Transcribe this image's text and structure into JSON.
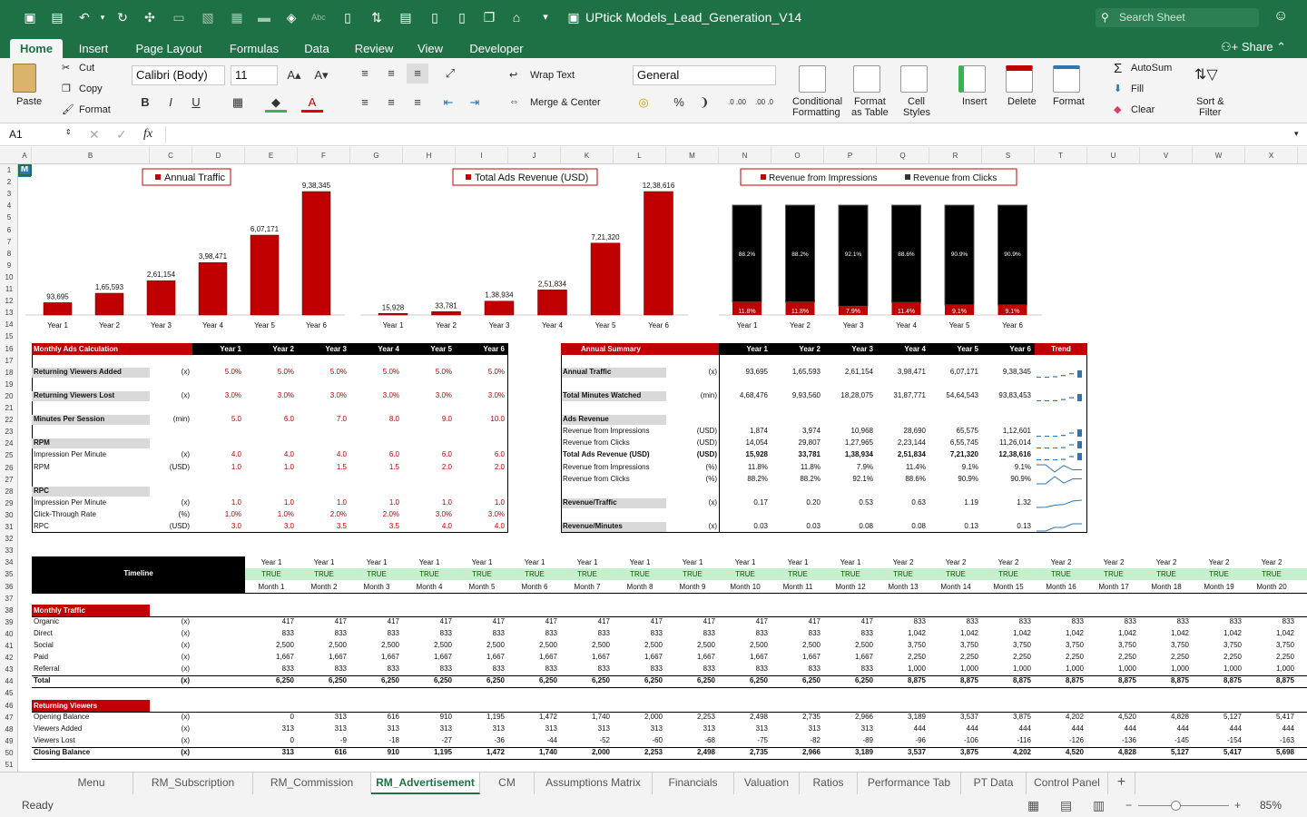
{
  "app": {
    "doc_title": "UPtick Models_Lead_Generation_V14",
    "search_placeholder": "Search Sheet",
    "share": "Share"
  },
  "ribbon_tabs": [
    "Home",
    "Insert",
    "Page Layout",
    "Formulas",
    "Data",
    "Review",
    "View",
    "Developer"
  ],
  "ribbon": {
    "paste": "Paste",
    "cut": "Cut",
    "copy": "Copy",
    "format_painter": "Format",
    "font_name": "Calibri (Body)",
    "font_size": "11",
    "wrap_text": "Wrap Text",
    "merge_center": "Merge & Center",
    "number_format": "General",
    "percent": "%",
    "conditional_formatting_1": "Conditional",
    "conditional_formatting_2": "Formatting",
    "format_table_1": "Format",
    "format_table_2": "as Table",
    "cell_styles_1": "Cell",
    "cell_styles_2": "Styles",
    "insert": "Insert",
    "delete": "Delete",
    "format": "Format",
    "autosum": "AutoSum",
    "fill": "Fill",
    "clear": "Clear",
    "sort_filter_1": "Sort &",
    "sort_filter_2": "Filter"
  },
  "name_box": "A1",
  "fx": "fx",
  "columns": [
    "A",
    "B",
    "C",
    "D",
    "E",
    "F",
    "G",
    "H",
    "I",
    "J",
    "K",
    "L",
    "M",
    "N",
    "O",
    "P",
    "Q",
    "R",
    "S",
    "T",
    "U",
    "V",
    "W",
    "X"
  ],
  "rows": [
    "1",
    "2",
    "3",
    "4",
    "5",
    "6",
    "7",
    "8",
    "9",
    "10",
    "11",
    "12",
    "13",
    "14",
    "15",
    "16",
    "17",
    "18",
    "19",
    "20",
    "21",
    "22",
    "23",
    "24",
    "25",
    "26",
    "27",
    "28",
    "29",
    "30",
    "31",
    "32",
    "33",
    "34",
    "35",
    "36",
    "37",
    "38",
    "39",
    "40",
    "41",
    "42",
    "43",
    "44",
    "45",
    "46",
    "47",
    "48",
    "49",
    "50",
    "51"
  ],
  "logo_letter": "M",
  "colors": {
    "accent": "#1e7145",
    "bar_red": "#c00000",
    "bar_black": "#000000",
    "trend_blue": "#2e75b6",
    "header_red": "#c00000",
    "timeline_green": "#c6efce"
  },
  "charts": [
    {
      "type": "bar",
      "legend": "Annual Traffic",
      "categories": [
        "Year 1",
        "Year 2",
        "Year 3",
        "Year 4",
        "Year 5",
        "Year 6"
      ],
      "values": [
        93695,
        165593,
        261154,
        398471,
        607171,
        938345
      ],
      "labels": [
        "93,695",
        "1,65,593",
        "2,61,154",
        "3,98,471",
        "6,07,171",
        "9,38,345"
      ],
      "ylim": [
        0,
        938345
      ]
    },
    {
      "type": "bar",
      "legend": "Total Ads Revenue (USD)",
      "categories": [
        "Year 1",
        "Year 2",
        "Year 3",
        "Year 4",
        "Year 5",
        "Year 6"
      ],
      "values": [
        15928,
        33781,
        138934,
        251834,
        721320,
        1238616
      ],
      "labels": [
        "15,928",
        "33,781",
        "1,38,934",
        "2,51,834",
        "7,21,320",
        "12,38,616"
      ],
      "ylim": [
        0,
        1238616
      ]
    },
    {
      "type": "stacked_bar_100",
      "legend": [
        "Revenue from Impressions",
        "Revenue from Clicks"
      ],
      "categories": [
        "Year 1",
        "Year 2",
        "Year 3",
        "Year 4",
        "Year 5",
        "Year 6"
      ],
      "series": [
        {
          "name": "Revenue from Impressions",
          "values": [
            11.8,
            11.8,
            7.9,
            11.4,
            9.1,
            9.1
          ],
          "labels": [
            "11.8%",
            "11.8%",
            "7.9%",
            "11.4%",
            "9.1%",
            "9.1%"
          ]
        },
        {
          "name": "Revenue from Clicks",
          "values": [
            88.2,
            88.2,
            92.1,
            88.6,
            90.9,
            90.9
          ],
          "labels": [
            "88.2%",
            "88.2%",
            "92.1%",
            "88.6%",
            "90.9%",
            "90.9%"
          ]
        }
      ]
    }
  ],
  "monthly_ads": {
    "title": "Monthly Ads Calculation",
    "years": [
      "Year 1",
      "Year 2",
      "Year 3",
      "Year 4",
      "Year 5",
      "Year 6"
    ],
    "rows": [
      {
        "label": "Returning Viewers Added",
        "unit": "(x)",
        "vals": [
          "5.0%",
          "5.0%",
          "5.0%",
          "5.0%",
          "5.0%",
          "5.0%"
        ],
        "hdr": true,
        "row": 18
      },
      {
        "label": "Returning Viewers Lost",
        "unit": "(x)",
        "vals": [
          "3.0%",
          "3.0%",
          "3.0%",
          "3.0%",
          "3.0%",
          "3.0%"
        ],
        "hdr": true,
        "row": 20
      },
      {
        "label": "Minutes Per Session",
        "unit": "(min)",
        "vals": [
          "5.0",
          "6.0",
          "7.0",
          "8.0",
          "9.0",
          "10.0"
        ],
        "hdr": true,
        "row": 22
      },
      {
        "label": "RPM",
        "unit": "",
        "vals": [
          "",
          "",
          "",
          "",
          "",
          ""
        ],
        "hdr": true,
        "row": 24
      },
      {
        "label": "Impression Per Minute",
        "unit": "(x)",
        "vals": [
          "4.0",
          "4.0",
          "4.0",
          "6.0",
          "6.0",
          "6.0"
        ],
        "hdr": false,
        "row": 25
      },
      {
        "label": "RPM",
        "unit": "(USD)",
        "vals": [
          "1.0",
          "1.0",
          "1.5",
          "1.5",
          "2.0",
          "2.0"
        ],
        "hdr": false,
        "row": 26
      },
      {
        "label": "RPC",
        "unit": "",
        "vals": [
          "",
          "",
          "",
          "",
          "",
          ""
        ],
        "hdr": true,
        "row": 28
      },
      {
        "label": "Impression Per Minute",
        "unit": "(x)",
        "vals": [
          "1.0",
          "1.0",
          "1.0",
          "1.0",
          "1.0",
          "1.0"
        ],
        "hdr": false,
        "row": 29
      },
      {
        "label": "Click-Through Rate",
        "unit": "(%)",
        "vals": [
          "1.0%",
          "1.0%",
          "2.0%",
          "2.0%",
          "3.0%",
          "3.0%"
        ],
        "hdr": false,
        "row": 30
      },
      {
        "label": "RPC",
        "unit": "(USD)",
        "vals": [
          "3.0",
          "3.0",
          "3.5",
          "3.5",
          "4.0",
          "4.0"
        ],
        "hdr": false,
        "row": 31
      }
    ]
  },
  "annual_summary": {
    "title": "Annual Summary",
    "years": [
      "Year 1",
      "Year 2",
      "Year 3",
      "Year 4",
      "Year 5",
      "Year 6"
    ],
    "trend": "Trend",
    "rows": [
      {
        "label": "Annual Traffic",
        "unit": "(x)",
        "vals": [
          "93,695",
          "1,65,593",
          "2,61,154",
          "3,98,471",
          "6,07,171",
          "9,38,345"
        ],
        "hdr": true,
        "bold": false,
        "row": 18,
        "trend": "bar"
      },
      {
        "label": "Total Minutes Watched",
        "unit": "(min)",
        "vals": [
          "4,68,476",
          "9,93,560",
          "18,28,075",
          "31,87,771",
          "54,64,543",
          "93,83,453"
        ],
        "hdr": true,
        "bold": false,
        "row": 20,
        "trend": "bar"
      },
      {
        "label": "Ads Revenue",
        "unit": "",
        "vals": [
          "",
          "",
          "",
          "",
          "",
          ""
        ],
        "hdr": true,
        "bold": false,
        "row": 22,
        "trend": ""
      },
      {
        "label": "Revenue from Impressions",
        "unit": "(USD)",
        "vals": [
          "1,874",
          "3,974",
          "10,968",
          "28,690",
          "65,575",
          "1,12,601"
        ],
        "hdr": false,
        "bold": false,
        "row": 23,
        "trend": "bar"
      },
      {
        "label": "Revenue from Clicks",
        "unit": "(USD)",
        "vals": [
          "14,054",
          "29,807",
          "1,27,965",
          "2,23,144",
          "6,55,745",
          "11,26,014"
        ],
        "hdr": false,
        "bold": false,
        "row": 24,
        "trend": "bar"
      },
      {
        "label": "Total Ads Revenue (USD)",
        "unit": "(USD)",
        "vals": [
          "15,928",
          "33,781",
          "1,38,934",
          "2,51,834",
          "7,21,320",
          "12,38,616"
        ],
        "hdr": false,
        "bold": true,
        "row": 25,
        "trend": "bar"
      },
      {
        "label": "Revenue from Impressions",
        "unit": "(%)",
        "vals": [
          "11.8%",
          "11.8%",
          "7.9%",
          "11.4%",
          "9.1%",
          "9.1%"
        ],
        "hdr": false,
        "bold": false,
        "row": 26,
        "trend": "line"
      },
      {
        "label": "Revenue from Clicks",
        "unit": "(%)",
        "vals": [
          "88.2%",
          "88.2%",
          "92.1%",
          "88.6%",
          "90.9%",
          "90.9%"
        ],
        "hdr": false,
        "bold": false,
        "row": 27,
        "trend": "line"
      },
      {
        "label": "Revenue/Traffic",
        "unit": "(x)",
        "vals": [
          "0.17",
          "0.20",
          "0.53",
          "0.63",
          "1.19",
          "1.32"
        ],
        "hdr": true,
        "bold": false,
        "row": 29,
        "trend": "line"
      },
      {
        "label": "Revenue/Minutes",
        "unit": "(x)",
        "vals": [
          "0.03",
          "0.03",
          "0.08",
          "0.08",
          "0.13",
          "0.13"
        ],
        "hdr": true,
        "bold": false,
        "row": 31,
        "trend": "line"
      }
    ]
  },
  "timeline": {
    "label": "Timeline",
    "years": [
      "Year 1",
      "Year 1",
      "Year 1",
      "Year 1",
      "Year 1",
      "Year 1",
      "Year 1",
      "Year 1",
      "Year 1",
      "Year 1",
      "Year 1",
      "Year 1",
      "Year 2",
      "Year 2",
      "Year 2",
      "Year 2",
      "Year 2",
      "Year 2",
      "Year 2",
      "Year 2"
    ],
    "flag": "TRUE",
    "months": [
      "Month 1",
      "Month 2",
      "Month 3",
      "Month 4",
      "Month 5",
      "Month 6",
      "Month 7",
      "Month 8",
      "Month 9",
      "Month 10",
      "Month 11",
      "Month 12",
      "Month 13",
      "Month 14",
      "Month 15",
      "Month 16",
      "Month 17",
      "Month 18",
      "Month 19",
      "Month 20"
    ]
  },
  "monthly_traffic": {
    "title": "Monthly Traffic",
    "rows": [
      {
        "label": "Organic",
        "unit": "(x)",
        "bold": false,
        "vals": [
          "417",
          "417",
          "417",
          "417",
          "417",
          "417",
          "417",
          "417",
          "417",
          "417",
          "417",
          "417",
          "833",
          "833",
          "833",
          "833",
          "833",
          "833",
          "833",
          "833"
        ]
      },
      {
        "label": "Direct",
        "unit": "(x)",
        "bold": false,
        "vals": [
          "833",
          "833",
          "833",
          "833",
          "833",
          "833",
          "833",
          "833",
          "833",
          "833",
          "833",
          "833",
          "1,042",
          "1,042",
          "1,042",
          "1,042",
          "1,042",
          "1,042",
          "1,042",
          "1,042"
        ]
      },
      {
        "label": "Social",
        "unit": "(x)",
        "bold": false,
        "vals": [
          "2,500",
          "2,500",
          "2,500",
          "2,500",
          "2,500",
          "2,500",
          "2,500",
          "2,500",
          "2,500",
          "2,500",
          "2,500",
          "2,500",
          "3,750",
          "3,750",
          "3,750",
          "3,750",
          "3,750",
          "3,750",
          "3,750",
          "3,750"
        ]
      },
      {
        "label": "Paid",
        "unit": "(x)",
        "bold": false,
        "vals": [
          "1,667",
          "1,667",
          "1,667",
          "1,667",
          "1,667",
          "1,667",
          "1,667",
          "1,667",
          "1,667",
          "1,667",
          "1,667",
          "1,667",
          "2,250",
          "2,250",
          "2,250",
          "2,250",
          "2,250",
          "2,250",
          "2,250",
          "2,250"
        ]
      },
      {
        "label": "Referral",
        "unit": "(x)",
        "bold": false,
        "vals": [
          "833",
          "833",
          "833",
          "833",
          "833",
          "833",
          "833",
          "833",
          "833",
          "833",
          "833",
          "833",
          "1,000",
          "1,000",
          "1,000",
          "1,000",
          "1,000",
          "1,000",
          "1,000",
          "1,000"
        ]
      },
      {
        "label": "Total",
        "unit": "(x)",
        "bold": true,
        "vals": [
          "6,250",
          "6,250",
          "6,250",
          "6,250",
          "6,250",
          "6,250",
          "6,250",
          "6,250",
          "6,250",
          "6,250",
          "6,250",
          "6,250",
          "8,875",
          "8,875",
          "8,875",
          "8,875",
          "8,875",
          "8,875",
          "8,875",
          "8,875"
        ]
      }
    ]
  },
  "returning_viewers": {
    "title": "Returning Viewers",
    "rows": [
      {
        "label": "Opening Balance",
        "unit": "(x)",
        "bold": false,
        "vals": [
          "0",
          "313",
          "616",
          "910",
          "1,195",
          "1,472",
          "1,740",
          "2,000",
          "2,253",
          "2,498",
          "2,735",
          "2,966",
          "3,189",
          "3,537",
          "3,875",
          "4,202",
          "4,520",
          "4,828",
          "5,127",
          "5,417"
        ]
      },
      {
        "label": "Viewers Added",
        "unit": "(x)",
        "bold": false,
        "vals": [
          "313",
          "313",
          "313",
          "313",
          "313",
          "313",
          "313",
          "313",
          "313",
          "313",
          "313",
          "313",
          "444",
          "444",
          "444",
          "444",
          "444",
          "444",
          "444",
          "444"
        ]
      },
      {
        "label": "Viewers Lost",
        "unit": "(x)",
        "bold": false,
        "vals": [
          "0",
          "-9",
          "-18",
          "-27",
          "-36",
          "-44",
          "-52",
          "-60",
          "-68",
          "-75",
          "-82",
          "-89",
          "-96",
          "-106",
          "-116",
          "-126",
          "-136",
          "-145",
          "-154",
          "-163"
        ]
      },
      {
        "label": "Closing Balance",
        "unit": "(x)",
        "bold": true,
        "vals": [
          "313",
          "616",
          "910",
          "1,195",
          "1,472",
          "1,740",
          "2,000",
          "2,253",
          "2,498",
          "2,735",
          "2,966",
          "3,189",
          "3,537",
          "3,875",
          "4,202",
          "4,520",
          "4,828",
          "5,127",
          "5,417",
          "5,698"
        ]
      }
    ]
  },
  "sheet_tabs": [
    "Menu",
    "RM_Subscription",
    "RM_Commission",
    "RM_Advertisement",
    "CM",
    "Assumptions Matrix",
    "Financials",
    "Valuation",
    "Ratios",
    "Performance Tab",
    "PT Data",
    "Control Panel"
  ],
  "active_sheet": "RM_Advertisement",
  "status": {
    "ready": "Ready",
    "zoom": "85%"
  }
}
